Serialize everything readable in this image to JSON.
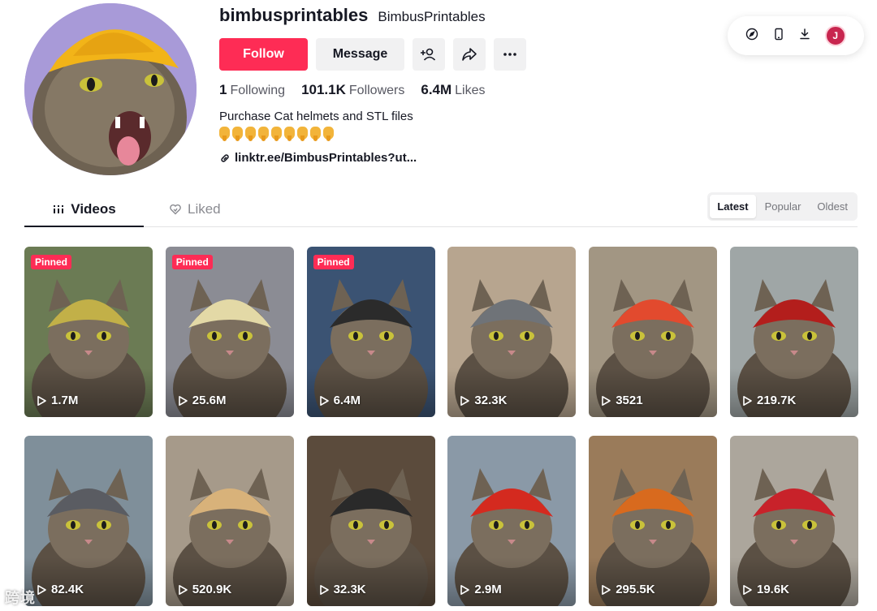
{
  "profile": {
    "username": "bimbusprintables",
    "nickname": "BimbusPrintables",
    "follow_label": "Follow",
    "message_label": "Message",
    "stats": [
      {
        "value": "1",
        "label": "Following"
      },
      {
        "value": "101.1K",
        "label": "Followers"
      },
      {
        "value": "6.4M",
        "label": "Likes"
      }
    ],
    "bio": "Purchase Cat helmets and STL files",
    "emoji_count": 9,
    "link": "linktr.ee/BimbusPrintables?ut..."
  },
  "tools": {
    "user_initial": "J",
    "icons": [
      "compass-icon",
      "phone-icon",
      "download-icon"
    ]
  },
  "tabs": {
    "videos_label": "Videos",
    "liked_label": "Liked"
  },
  "sort": {
    "latest": "Latest",
    "popular": "Popular",
    "oldest": "Oldest",
    "active": "Latest"
  },
  "pinned_label": "Pinned",
  "videos": [
    {
      "views": "1.7M",
      "pinned": true,
      "bg": "#6b7b54",
      "hat": "#c2b048"
    },
    {
      "views": "25.6M",
      "pinned": true,
      "bg": "#8b8c94",
      "hat": "#e3d9a6"
    },
    {
      "views": "6.4M",
      "pinned": true,
      "bg": "#3b5373",
      "hat": "#2b2b2b"
    },
    {
      "views": "32.3K",
      "pinned": false,
      "bg": "#b7a58f",
      "hat": "#6f7378"
    },
    {
      "views": "3521",
      "pinned": false,
      "bg": "#a29683",
      "hat": "#e24a2e"
    },
    {
      "views": "219.7K",
      "pinned": false,
      "bg": "#9fa6a6",
      "hat": "#b31e1c"
    },
    {
      "views": "82.4K",
      "pinned": false,
      "bg": "#7f8f9a",
      "hat": "#5a5c62"
    },
    {
      "views": "520.9K",
      "pinned": false,
      "bg": "#a69a8a",
      "hat": "#d8b27a"
    },
    {
      "views": "32.3K",
      "pinned": false,
      "bg": "#5b4b3c",
      "hat": "#2a2a2a"
    },
    {
      "views": "2.9M",
      "pinned": false,
      "bg": "#8a99a7",
      "hat": "#d42a1f"
    },
    {
      "views": "295.5K",
      "pinned": false,
      "bg": "#9a7b5a",
      "hat": "#d86a1e"
    },
    {
      "views": "19.6K",
      "pinned": false,
      "bg": "#aca69c",
      "hat": "#c8222a"
    }
  ],
  "watermark": "跨境"
}
